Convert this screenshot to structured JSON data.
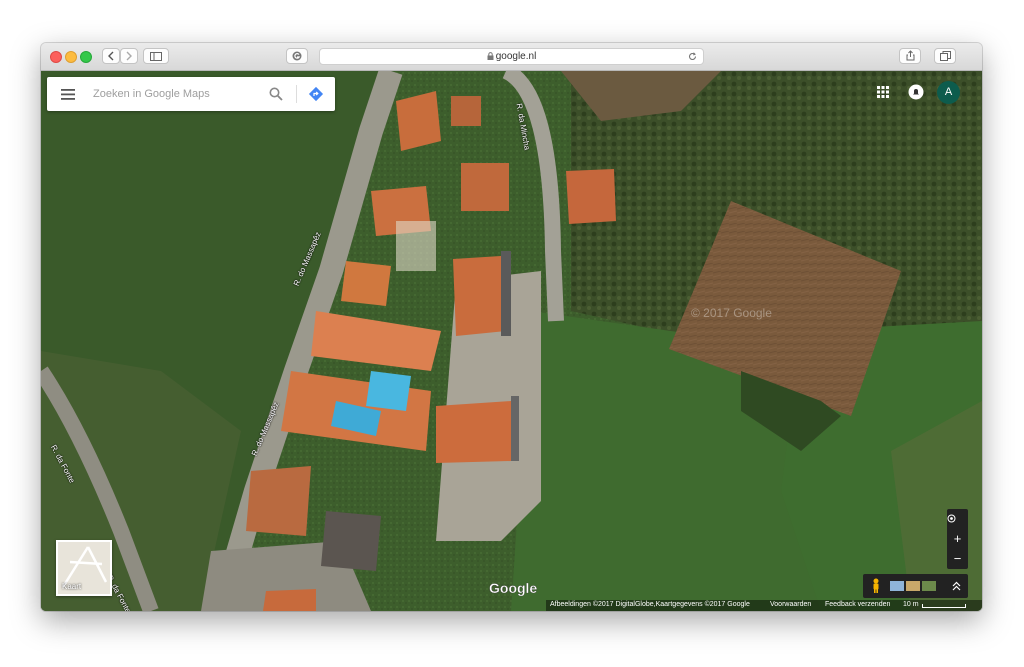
{
  "browser": {
    "url_text": "google.nl"
  },
  "map": {
    "search_placeholder": "Zoeken in Google Maps",
    "streets": [
      "R. do Massapêz",
      "R. do Massapêz",
      "R. da Mincha",
      "R. da Fonte",
      "R. da Fonte"
    ],
    "watermark": "© 2017 Google",
    "logo": "Google",
    "layer_toggle_label": "Kaart",
    "account_initial": "A",
    "attribution": {
      "imagery": "Afbeeldingen ©2017 DigitalGlobe,Kaartgegevens ©2017 Google",
      "terms": "Voorwaarden",
      "feedback": "Feedback verzenden",
      "scale": "10 m"
    },
    "zoom_in": "+",
    "zoom_out": "−"
  }
}
